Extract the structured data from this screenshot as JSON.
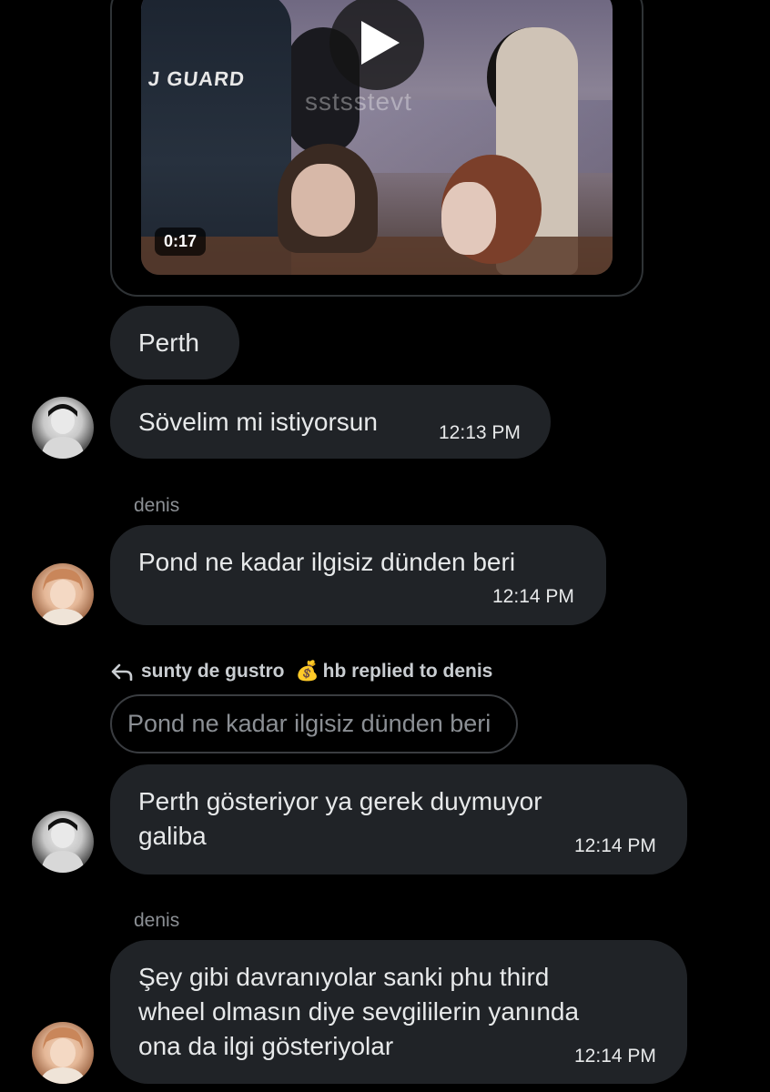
{
  "video": {
    "duration": "0:17",
    "overlay_text": "J GUARD",
    "watermark": "sstsstevt",
    "icon": "play-icon"
  },
  "messages": [
    {
      "text": "Perth"
    },
    {
      "text": "Sövelim mi istiyorsun",
      "time": "12:13 PM"
    },
    {
      "sender": "denis",
      "text": "Pond ne kadar ilgisiz dünden beri",
      "time": "12:14 PM"
    },
    {
      "reply_sender": "sunty de gustro",
      "reply_emoji": "💰",
      "reply_suffix": "hb replied to denis",
      "quoted_text": "Pond ne kadar ilgisiz dünden beri",
      "text_line1": "Perth gösteriyor ya gerek duymuyor",
      "text_line2": "galiba",
      "time": "12:14 PM"
    },
    {
      "sender": "denis",
      "text_line1": "Şey gibi davranıyolar sanki phu third",
      "text_line2": "wheel olmasın diye sevgililerin yanında",
      "text_line3": "ona da ilgi gösteriyolar",
      "time": "12:14 PM"
    }
  ],
  "colors": {
    "background": "#000000",
    "bubble": "#202327",
    "muted_text": "#8b8f94"
  }
}
